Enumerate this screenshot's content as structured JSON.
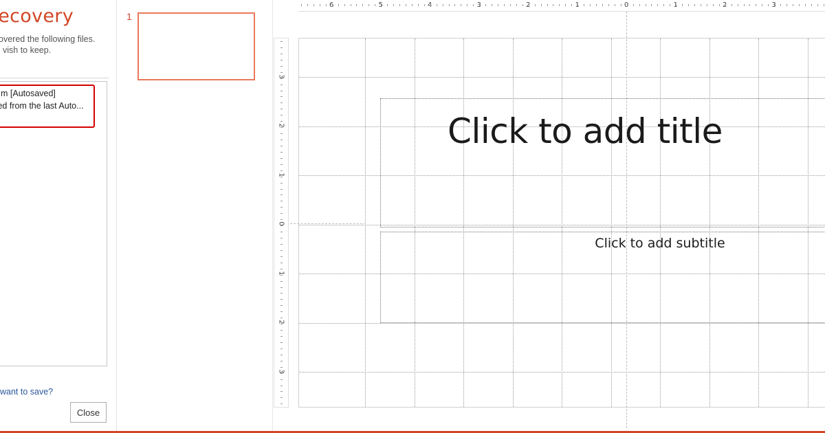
{
  "recovery": {
    "title": "t Recovery",
    "desc_line1": "overed the following files.",
    "desc_line2": "vish to keep.",
    "file": {
      "name": "m  [Autosaved]",
      "sub": "ted from the last Auto..."
    },
    "save_question": "want to save?",
    "close_label": "Close"
  },
  "thumbnails": {
    "slide_number": "1"
  },
  "ruler": {
    "horizontal": [
      "6",
      "5",
      "4",
      "3",
      "2",
      "1",
      "0",
      "1",
      "2",
      "3"
    ],
    "vertical": [
      "3",
      "2",
      "1",
      "0",
      "1",
      "2",
      "3"
    ]
  },
  "slide": {
    "title_placeholder": "Click to add title",
    "subtitle_placeholder": "Click to add subtitle"
  },
  "colors": {
    "accent": "#d24726",
    "highlight_border": "#d40000",
    "link": "#2b579a"
  }
}
